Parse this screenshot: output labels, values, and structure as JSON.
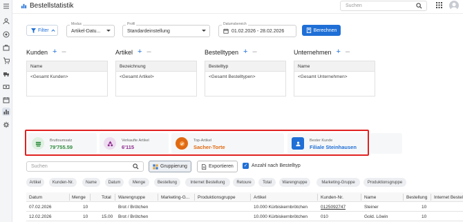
{
  "header": {
    "title": "Bestellstatistik",
    "search_placeholder": "Suchen"
  },
  "sidebar": {
    "icons": [
      "menu-icon",
      "users-icon",
      "target-icon",
      "briefcase-icon",
      "cart-icon",
      "truck-icon",
      "money-icon",
      "calendar-icon",
      "chart-icon",
      "gear-icon"
    ],
    "active_index": 8
  },
  "toolbar": {
    "filter_label": "Filter",
    "modus": {
      "label": "Modus",
      "value": "Artikel-Datu..."
    },
    "profil": {
      "label": "Profil",
      "value": "Standardeinstellung"
    },
    "datum": {
      "label": "Datumsbereich",
      "value": "01.02.2026 - 28.02.2026"
    },
    "berechnen_label": "Berechnen"
  },
  "sections": [
    {
      "title": "Kunden",
      "column": "Name",
      "item": "<Gesamt Kunden>"
    },
    {
      "title": "Artikel",
      "column": "Bezeichnung",
      "item": "<Gesamt Artikel>"
    },
    {
      "title": "Bestelltypen",
      "column": "Bestelltyp",
      "item": "<Gesamt Bestelltypen>"
    },
    {
      "title": "Unternehmen",
      "column": "Name",
      "item": "<Gesamt Unternehmen>"
    }
  ],
  "kpis": [
    {
      "label": "Bruttoumsatz",
      "value": "79'755.59",
      "color": "#2e8b3e",
      "bg": "#dff0e2"
    },
    {
      "label": "Verkaufte Artikel",
      "value": "6'115",
      "color": "#8e2a8e",
      "bg": "#eddcf0"
    },
    {
      "label": "Top-Artikel",
      "value": "Sacher-Torte",
      "color": "#e06a12",
      "bg": "#fbe4d0"
    },
    {
      "label": "Bester Kunde",
      "value": "Filiale Steinhausen",
      "color": "#1f6fd6",
      "bg": "#dde9f8"
    }
  ],
  "controls": {
    "search_placeholder": "Suchen",
    "gruppierung_label": "Gruppierung",
    "exportieren_label": "Exportieren",
    "checkbox_label": "Anzahl nach Bestelltyp"
  },
  "chips": [
    "Artikel",
    "Kunden-Nr.",
    "Name",
    "Datum",
    "Menge",
    "Bestellung",
    "Internet Bestellung",
    "Retoure",
    "Total",
    "Warengruppe",
    "Marketing-Gruppe",
    "Produktionsgruppe"
  ],
  "table": {
    "columns": [
      "Datum",
      "Menge",
      "Total",
      "Warengruppe",
      "Marketing-G...",
      "Produktionsgruppe",
      "Artikel",
      "Kunden-Nr.",
      "Name",
      "Bestellung",
      "Internet Bestell"
    ],
    "rows": [
      [
        "07.02.2026",
        "10",
        "",
        "Brot / Brötchen",
        "",
        "",
        "10.000 Kürbiskernbrötchen",
        "0125092747",
        "Steiner",
        "10",
        ""
      ],
      [
        "12.02.2026",
        "10",
        "15.00",
        "Brot / Brötchen",
        "",
        "",
        "10.000 Kürbiskernbrötchen",
        "010",
        "Gold. Löwin",
        "10",
        ""
      ]
    ]
  }
}
